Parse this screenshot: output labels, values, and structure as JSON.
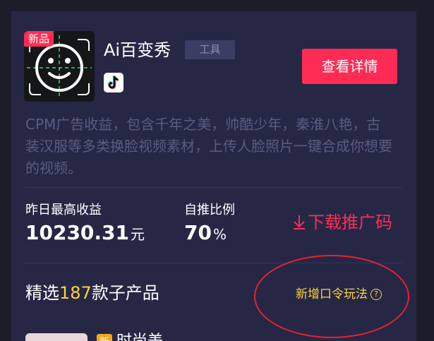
{
  "product": {
    "badge": "新品",
    "title": "Ai百变秀",
    "tag": "工具",
    "platform_icon": "tiktok-icon",
    "detail_button": "查看详情",
    "description": "CPM广告收益，包含千年之美，帅酷少年，秦淮八艳，古装汉服等多类换脸视频素材，上传人脸照片一键合成你想要的视频。"
  },
  "stats": {
    "yesterday_label": "昨日最高收益",
    "yesterday_value": "10230.31",
    "yesterday_unit": "元",
    "ratio_label": "自推比例",
    "ratio_value": "70",
    "ratio_unit": "%",
    "download_label": "下载推广码"
  },
  "section": {
    "prefix": "精选",
    "count": "187",
    "suffix": "款子产品",
    "new_mode_label": "新增口令玩法",
    "help_symbol": "?"
  },
  "sub_item": {
    "badge": "新",
    "name": "时尚美"
  },
  "colors": {
    "background": "#1b1d2b",
    "card": "#262745",
    "accent": "#fe2c55",
    "highlight": "#ffd23f",
    "annotation": "#e8222c"
  }
}
